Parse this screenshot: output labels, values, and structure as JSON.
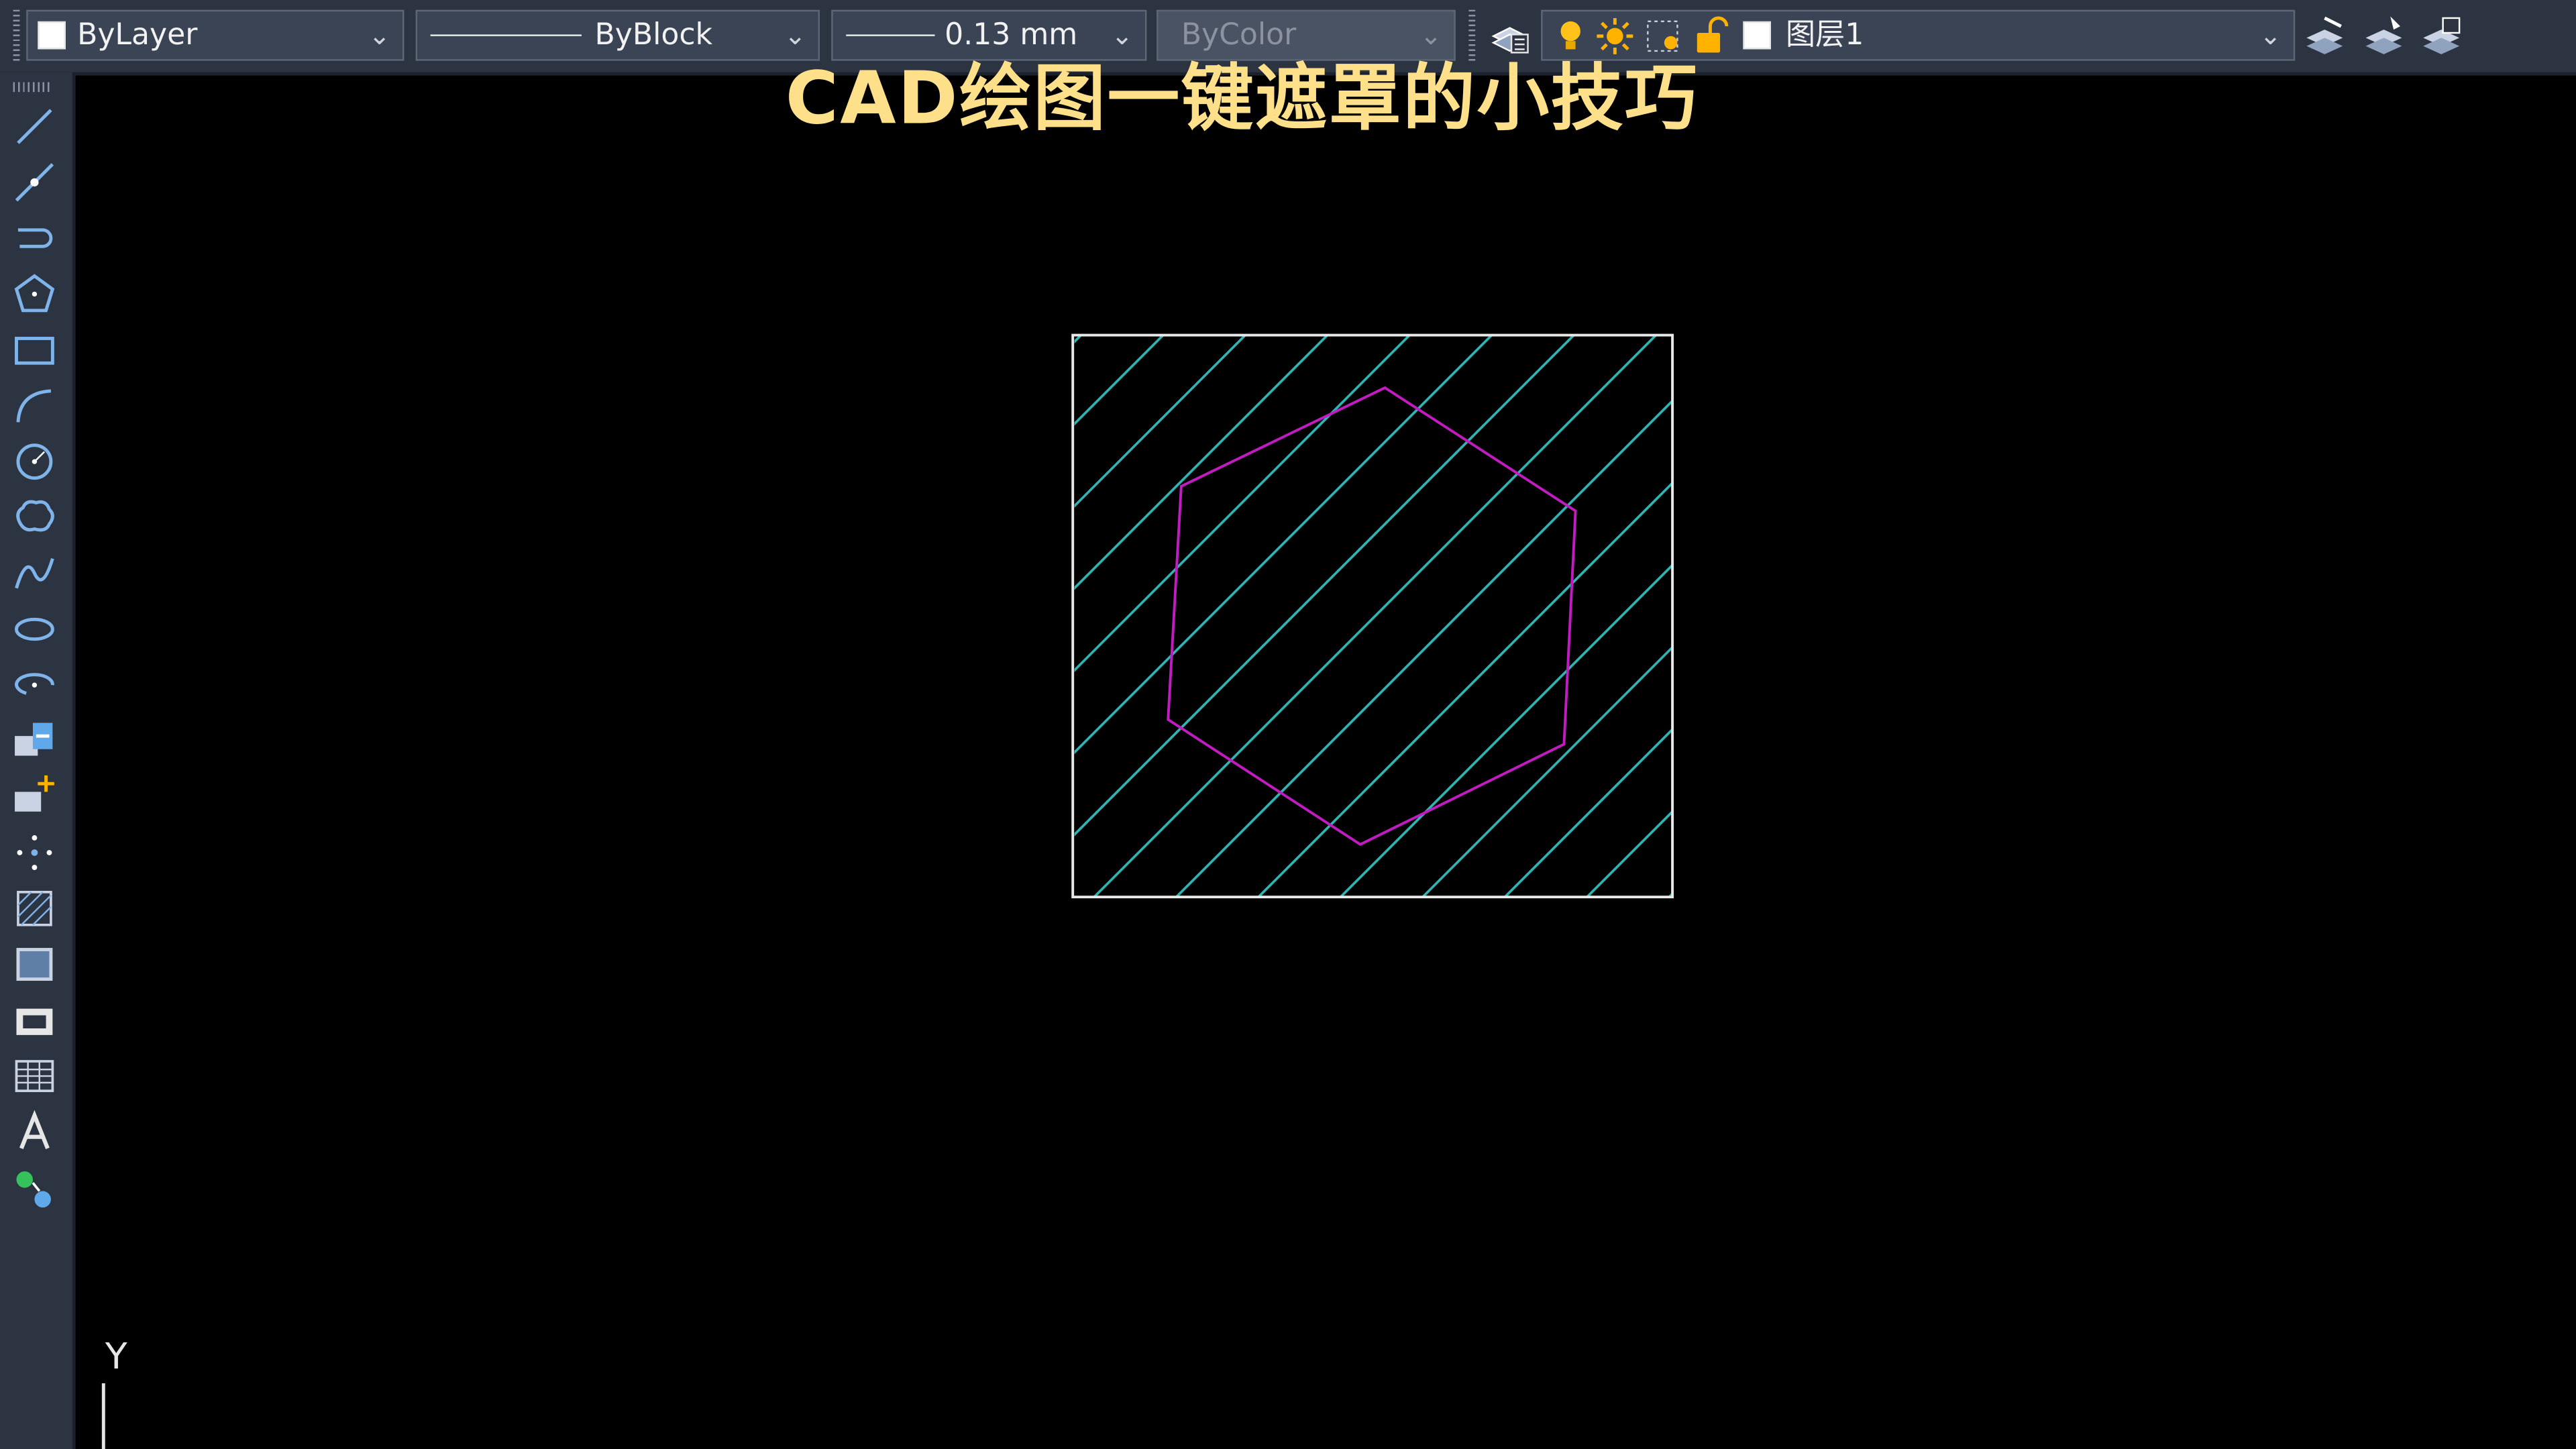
{
  "toolbar": {
    "color_combo": {
      "value": "ByLayer"
    },
    "linetype_combo": {
      "value": "ByBlock"
    },
    "lineweight_combo": {
      "value": "0.13 mm"
    },
    "plotstyle_combo": {
      "value": "ByColor",
      "disabled": true
    },
    "layer_combo": {
      "value": "图层1"
    },
    "icons": [
      "layer-properties-icon",
      "layer-on-icon",
      "layer-thaw-icon",
      "layer-viewport-icon",
      "layer-unlock-icon",
      "layer-color-swatch",
      "make-current-layer-icon",
      "layer-match-icon",
      "layer-previous-icon"
    ]
  },
  "left_toolbar": {
    "tools": [
      "line-icon",
      "construction-line-icon",
      "polyline-icon",
      "polygon-icon",
      "rectangle-icon",
      "arc-icon",
      "circle-icon",
      "revision-cloud-icon",
      "spline-icon",
      "ellipse-icon",
      "ellipse-arc-icon",
      "insert-block-icon",
      "make-block-icon",
      "point-icon",
      "hatch-icon",
      "region-icon",
      "wipeout-icon",
      "table-icon",
      "mtext-icon",
      "add-selected-icon"
    ]
  },
  "canvas": {
    "title": "CAD绘图一键遮罩的小技巧",
    "ucs_label": "Y",
    "colors": {
      "title": "#ffe08a",
      "hatch": "#2fb3b3",
      "hexagon": "#c21bc2",
      "boundary": "#e8e8e8",
      "background": "#000000"
    }
  }
}
